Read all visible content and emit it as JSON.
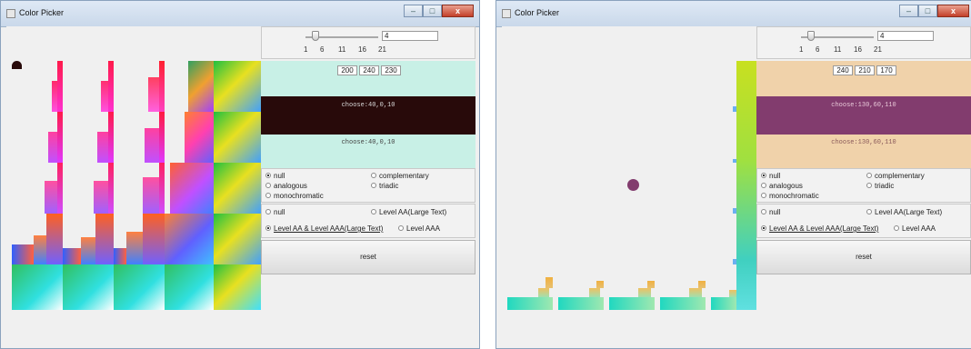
{
  "windows": [
    {
      "title": "Color Picker",
      "slider": {
        "value": "4",
        "ticks": [
          "1",
          "6",
          "11",
          "16",
          "21"
        ]
      },
      "rgb": [
        "200",
        "240",
        "230"
      ],
      "bg_color": "#c8f0e6",
      "choose_color": "#280a0a",
      "choose_label_top": "choose:40,0,10",
      "choose_label_bottom": "choose:40,0,10",
      "scheme_options": [
        "null",
        "complementary",
        "analogous",
        "triadic",
        "monochromatic"
      ],
      "scheme_selected": "null",
      "level_options": [
        "null",
        "Level AA(Large Text)",
        "Level AA & Level AAA(Large Text)",
        "Level AAA"
      ],
      "level_selected": "Level AA & Level AAA(Large Text)",
      "reset_label": "reset",
      "dot_color": "#280a0a"
    },
    {
      "title": "Color Picker",
      "slider": {
        "value": "4",
        "ticks": [
          "1",
          "6",
          "11",
          "16",
          "21"
        ]
      },
      "rgb": [
        "240",
        "210",
        "170"
      ],
      "bg_color": "#f0d2aa",
      "choose_color": "#823c6e",
      "choose_label_top": "choose:130,60,110",
      "choose_label_bottom": "choose:130,60,110",
      "scheme_options": [
        "null",
        "complementary",
        "analogous",
        "triadic",
        "monochromatic"
      ],
      "scheme_selected": "null",
      "level_options": [
        "null",
        "Level AA(Large Text)",
        "Level AA & Level AAA(Large Text)",
        "Level AAA"
      ],
      "level_selected": "Level AA & Level AAA(Large Text)",
      "reset_label": "reset",
      "dot_color": "#823c6e"
    }
  ]
}
